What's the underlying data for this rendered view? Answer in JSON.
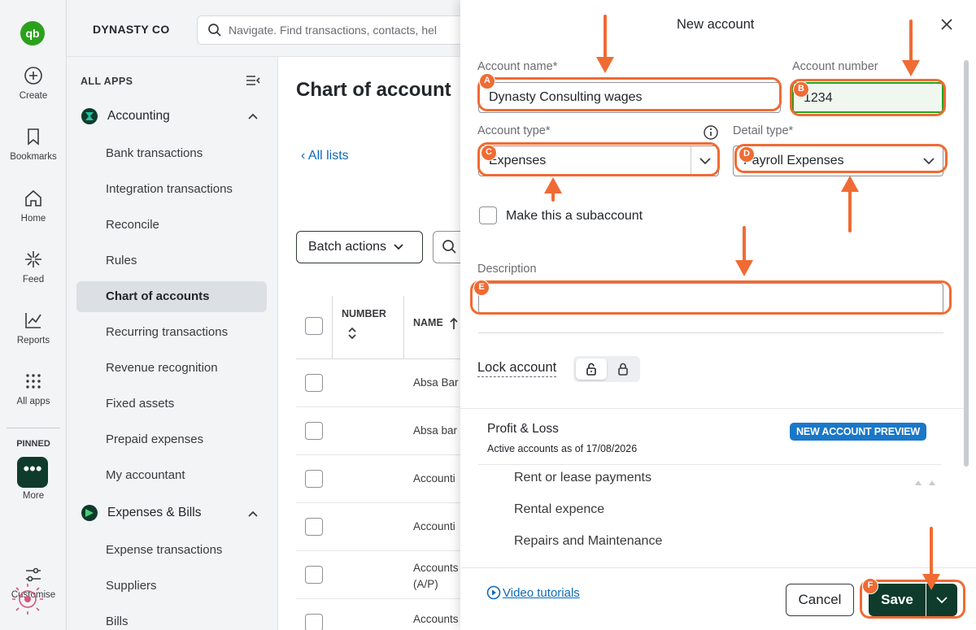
{
  "rail": {
    "logo": "qb",
    "items": [
      {
        "label": "Create",
        "icon": "plus-circle-icon"
      },
      {
        "label": "Bookmarks",
        "icon": "bookmark-icon"
      },
      {
        "label": "Home",
        "icon": "home-icon"
      },
      {
        "label": "Feed",
        "icon": "feed-icon"
      },
      {
        "label": "Reports",
        "icon": "reports-icon"
      },
      {
        "label": "All apps",
        "icon": "grid-icon"
      }
    ],
    "pinned_label": "PINNED",
    "more_label": "More",
    "more_glyph": "•••",
    "customise_label": "Customise"
  },
  "topbar": {
    "company": "DYNASTY CO",
    "search_placeholder": "Navigate. Find transactions, contacts, hel"
  },
  "menu": {
    "all_apps": "ALL APPS",
    "accounting": {
      "label": "Accounting",
      "items": [
        "Bank transactions",
        "Integration transactions",
        "Reconcile",
        "Rules",
        "Chart of accounts",
        "Recurring transactions",
        "Revenue recognition",
        "Fixed assets",
        "Prepaid expenses",
        "My accountant"
      ]
    },
    "expenses": {
      "label": "Expenses & Bills",
      "items": [
        "Expense transactions",
        "Suppliers",
        "Bills"
      ]
    },
    "active_item": "Chart of accounts"
  },
  "main": {
    "title": "Chart of account",
    "back": "All lists",
    "batch": "Batch actions",
    "col_number": "NUMBER",
    "col_name": "NAME",
    "rows": [
      "Absa Bar",
      "Absa bar",
      "Accounti",
      "Accounti",
      "Accounts",
      "Accounts"
    ],
    "row5_sub": "(A/P)"
  },
  "panel": {
    "title": "New account",
    "account_name_label": "Account name*",
    "account_name_value": "Dynasty Consulting wages",
    "account_number_label": "Account number",
    "account_number_value": "1234",
    "account_type_label": "Account type*",
    "account_type_value": "Expenses",
    "detail_type_label": "Detail type*",
    "detail_type_value": "Payroll Expenses",
    "subaccount_label": "Make this a subaccount",
    "description_label": "Description",
    "description_value": "",
    "lock_label": "Lock account",
    "preview": {
      "heading": "Profit & Loss",
      "as_of": "Active accounts as of 17/08/2026",
      "badge": "NEW ACCOUNT PREVIEW",
      "items": [
        "Rent or lease payments",
        "Rental expence",
        "Repairs and Maintenance"
      ]
    },
    "video_tutorials": "Video tutorials",
    "cancel": "Cancel",
    "save": "Save"
  },
  "annotations": {
    "labels": [
      "A",
      "B",
      "C",
      "D",
      "E",
      "F"
    ],
    "color": "#f06b34"
  },
  "colors": {
    "brand_green": "#2ca01c",
    "dark_green": "#0e3b2c",
    "link_blue": "#0d6bb8",
    "badge_blue": "#1a78c8"
  }
}
